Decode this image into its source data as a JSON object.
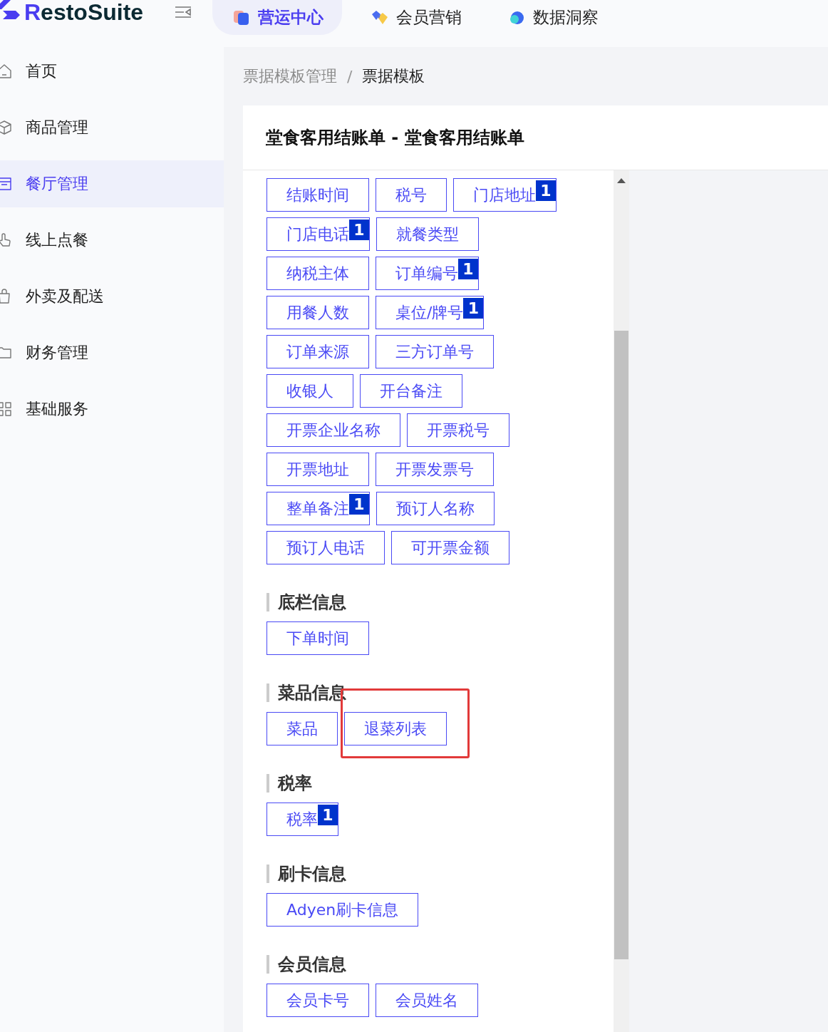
{
  "logo": {
    "accent": "R",
    "text": "estoSuite"
  },
  "top_tabs": [
    {
      "label": "营运中心",
      "selected": true,
      "kind": "ops"
    },
    {
      "label": "会员营销",
      "selected": false,
      "kind": "member"
    },
    {
      "label": "数据洞察",
      "selected": false,
      "kind": "data"
    }
  ],
  "sidebar": {
    "items": [
      {
        "label": "首页",
        "selected": false,
        "kind": "home"
      },
      {
        "label": "商品管理",
        "selected": false,
        "kind": "box"
      },
      {
        "label": "餐厅管理",
        "selected": true,
        "kind": "shop"
      },
      {
        "label": "线上点餐",
        "selected": false,
        "kind": "hand"
      },
      {
        "label": "外卖及配送",
        "selected": false,
        "kind": "bag"
      },
      {
        "label": "财务管理",
        "selected": false,
        "kind": "folder"
      },
      {
        "label": "基础服务",
        "selected": false,
        "kind": "grid"
      }
    ]
  },
  "breadcrumb": [
    {
      "label": "票据模板管理",
      "current": false
    },
    {
      "label": "票据模板",
      "current": true
    }
  ],
  "breadcrumb_separator": "/",
  "card_title": "堂食客用结账单 - 堂食客用结账单",
  "sections": [
    {
      "rows": [
        [
          {
            "label": "结账时间"
          },
          {
            "label": "税号"
          },
          {
            "label": "门店地址",
            "badge": "1"
          }
        ],
        [
          {
            "label": "门店电话",
            "badge": "1"
          },
          {
            "label": "就餐类型"
          }
        ],
        [
          {
            "label": "纳税主体"
          },
          {
            "label": "订单编号",
            "badge": "1"
          }
        ],
        [
          {
            "label": "用餐人数"
          },
          {
            "label": "桌位/牌号",
            "badge": "1"
          }
        ],
        [
          {
            "label": "订单来源"
          },
          {
            "label": "三方订单号"
          }
        ],
        [
          {
            "label": "收银人"
          },
          {
            "label": "开台备注"
          }
        ],
        [
          {
            "label": "开票企业名称"
          },
          {
            "label": "开票税号"
          }
        ],
        [
          {
            "label": "开票地址"
          },
          {
            "label": "开票发票号"
          }
        ],
        [
          {
            "label": "整单备注",
            "badge": "1"
          },
          {
            "label": "预订人名称"
          }
        ],
        [
          {
            "label": "预订人电话"
          },
          {
            "label": "可开票金额"
          }
        ]
      ]
    },
    {
      "title": "底栏信息",
      "rows": [
        [
          {
            "label": "下单时间"
          }
        ]
      ]
    },
    {
      "title": "菜品信息",
      "rows": [
        [
          {
            "label": "菜品"
          },
          {
            "label": "退菜列表",
            "highlighted": true
          }
        ]
      ]
    },
    {
      "title": "税率",
      "rows": [
        [
          {
            "label": "税率",
            "badge": "1"
          }
        ]
      ]
    },
    {
      "title": "刷卡信息",
      "rows": [
        [
          {
            "label": "Adyen刷卡信息"
          }
        ]
      ]
    },
    {
      "title": "会员信息",
      "rows": [
        [
          {
            "label": "会员卡号"
          },
          {
            "label": "会员姓名"
          }
        ]
      ]
    }
  ]
}
